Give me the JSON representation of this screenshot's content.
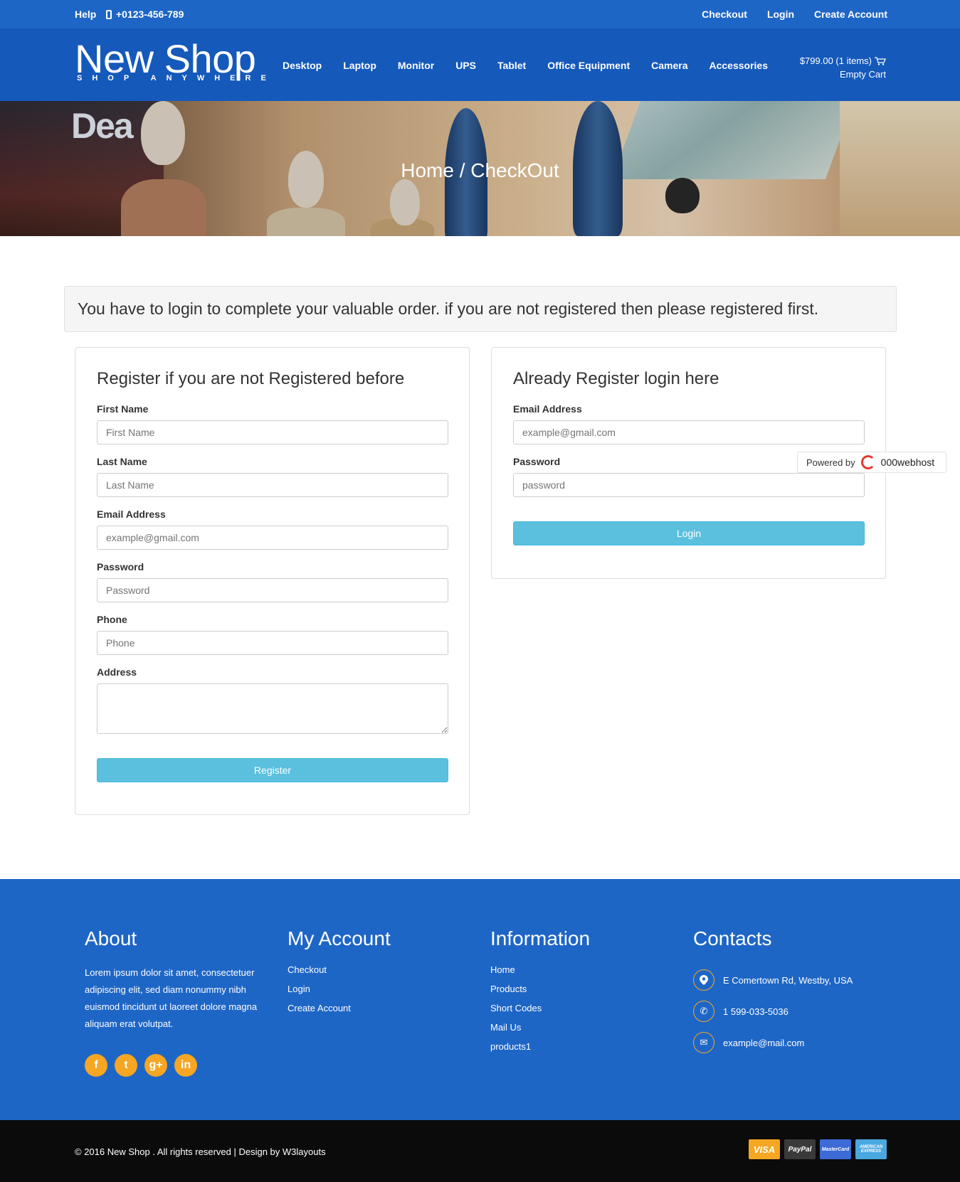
{
  "topbar": {
    "help": "Help",
    "phone": "+0123-456-789",
    "links": [
      "Checkout",
      "Login",
      "Create Account"
    ]
  },
  "header": {
    "logo_name": "New Shop",
    "logo_tag": "SHOP ANYWHERE",
    "nav": [
      "Desktop",
      "Laptop",
      "Monitor",
      "UPS",
      "Tablet",
      "Office Equipment",
      "Camera",
      "Accessories"
    ],
    "cart_total": "$799.00 (1 items)",
    "cart_empty": "Empty Cart"
  },
  "banner": {
    "breadcrumb": "Home / CheckOut",
    "sign_text": "Dea"
  },
  "alert": "You have to login to complete your valuable order. if you are not registered then please registered first.",
  "register": {
    "title": "Register if you are not Registered before",
    "fields": [
      {
        "label": "First Name",
        "placeholder": "First Name"
      },
      {
        "label": "Last Name",
        "placeholder": "Last Name"
      },
      {
        "label": "Email Address",
        "placeholder": "example@gmail.com"
      },
      {
        "label": "Password",
        "placeholder": "Password"
      },
      {
        "label": "Phone",
        "placeholder": "Phone"
      },
      {
        "label": "Address",
        "placeholder": ""
      }
    ],
    "button": "Register"
  },
  "login": {
    "title": "Already Register login here",
    "fields": [
      {
        "label": "Email Address",
        "placeholder": "example@gmail.com"
      },
      {
        "label": "Password",
        "placeholder": "password"
      }
    ],
    "button": "Login"
  },
  "powered": {
    "text": "Powered by",
    "brand": "000webhost"
  },
  "footer": {
    "about_title": "About",
    "about_text": "Lorem ipsum dolor sit amet, consectetuer adipiscing elit, sed diam nonummy nibh euismod tincidunt ut laoreet dolore magna aliquam erat volutpat.",
    "social": [
      "f",
      "t",
      "g+",
      "in"
    ],
    "account_title": "My Account",
    "account_links": [
      "Checkout",
      "Login",
      "Create Account"
    ],
    "info_title": "Information",
    "info_links": [
      "Home",
      "Products",
      "Short Codes",
      "Mail Us",
      "products1"
    ],
    "contacts_title": "Contacts",
    "contacts": [
      {
        "icon": "map-pin-icon",
        "text": "E Comertown Rd, Westby, USA"
      },
      {
        "icon": "phone-icon",
        "text": "1 599-033-5036"
      },
      {
        "icon": "envelope-icon",
        "text": "example@mail.com"
      }
    ]
  },
  "bottom": {
    "copyright": "© 2016 New Shop . All rights reserved | Design by  W3layouts",
    "cards": [
      "VISA",
      "PayPal",
      "MasterCard",
      "AMERICAN EXPRESS"
    ]
  },
  "colors": {
    "topbar": "#1e66c6",
    "header": "#1559bb",
    "footer": "#1e66c6",
    "button": "#5bc0de",
    "social": "#f5a623",
    "bottom": "#0b0b0b"
  }
}
